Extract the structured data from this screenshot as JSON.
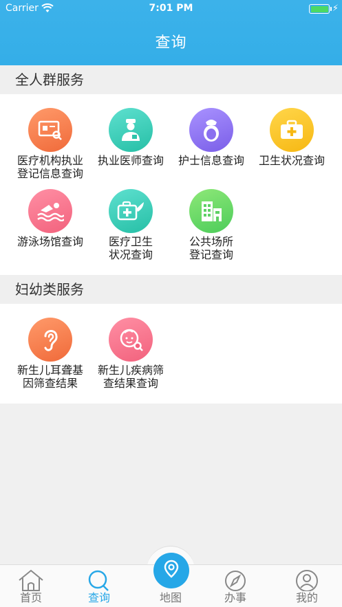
{
  "statusbar": {
    "carrier": "Carrier",
    "time": "7:01 PM"
  },
  "header": {
    "title": "查询"
  },
  "sections": [
    {
      "title": "全人群服务",
      "items": [
        {
          "label1": "医疗机构执业",
          "label2": "登记信息查询",
          "icon": "certificate-search-icon"
        },
        {
          "label1": "执业医师查询",
          "label2": "",
          "icon": "doctor-icon"
        },
        {
          "label1": "护士信息查询",
          "label2": "",
          "icon": "nurse-icon"
        },
        {
          "label1": "卫生状况查询",
          "label2": "",
          "icon": "first-aid-kit-icon"
        },
        {
          "label1": "游泳场馆查询",
          "label2": "",
          "icon": "swimmer-icon"
        },
        {
          "label1": "医疗卫生",
          "label2": "状况查询",
          "icon": "medical-kit-leaf-icon"
        },
        {
          "label1": "公共场所",
          "label2": "登记查询",
          "icon": "building-icon"
        }
      ]
    },
    {
      "title": "妇幼类服务",
      "items": [
        {
          "label1": "新生儿耳聋基",
          "label2": "因筛查结果",
          "icon": "ear-icon"
        },
        {
          "label1": "新生儿疾病筛",
          "label2": "查结果查询",
          "icon": "baby-search-icon"
        }
      ]
    }
  ],
  "tabbar": {
    "tabs": [
      {
        "label": "首页",
        "icon": "home-icon"
      },
      {
        "label": "查询",
        "icon": "search-icon"
      },
      {
        "label": "地图",
        "icon": "map-pin-icon"
      },
      {
        "label": "办事",
        "icon": "compass-icon"
      },
      {
        "label": "我的",
        "icon": "user-icon"
      }
    ],
    "active_index": 1
  },
  "colors": {
    "brand": "#34aee8",
    "active_tab": "#27a7e7",
    "battery": "#4cd964"
  }
}
